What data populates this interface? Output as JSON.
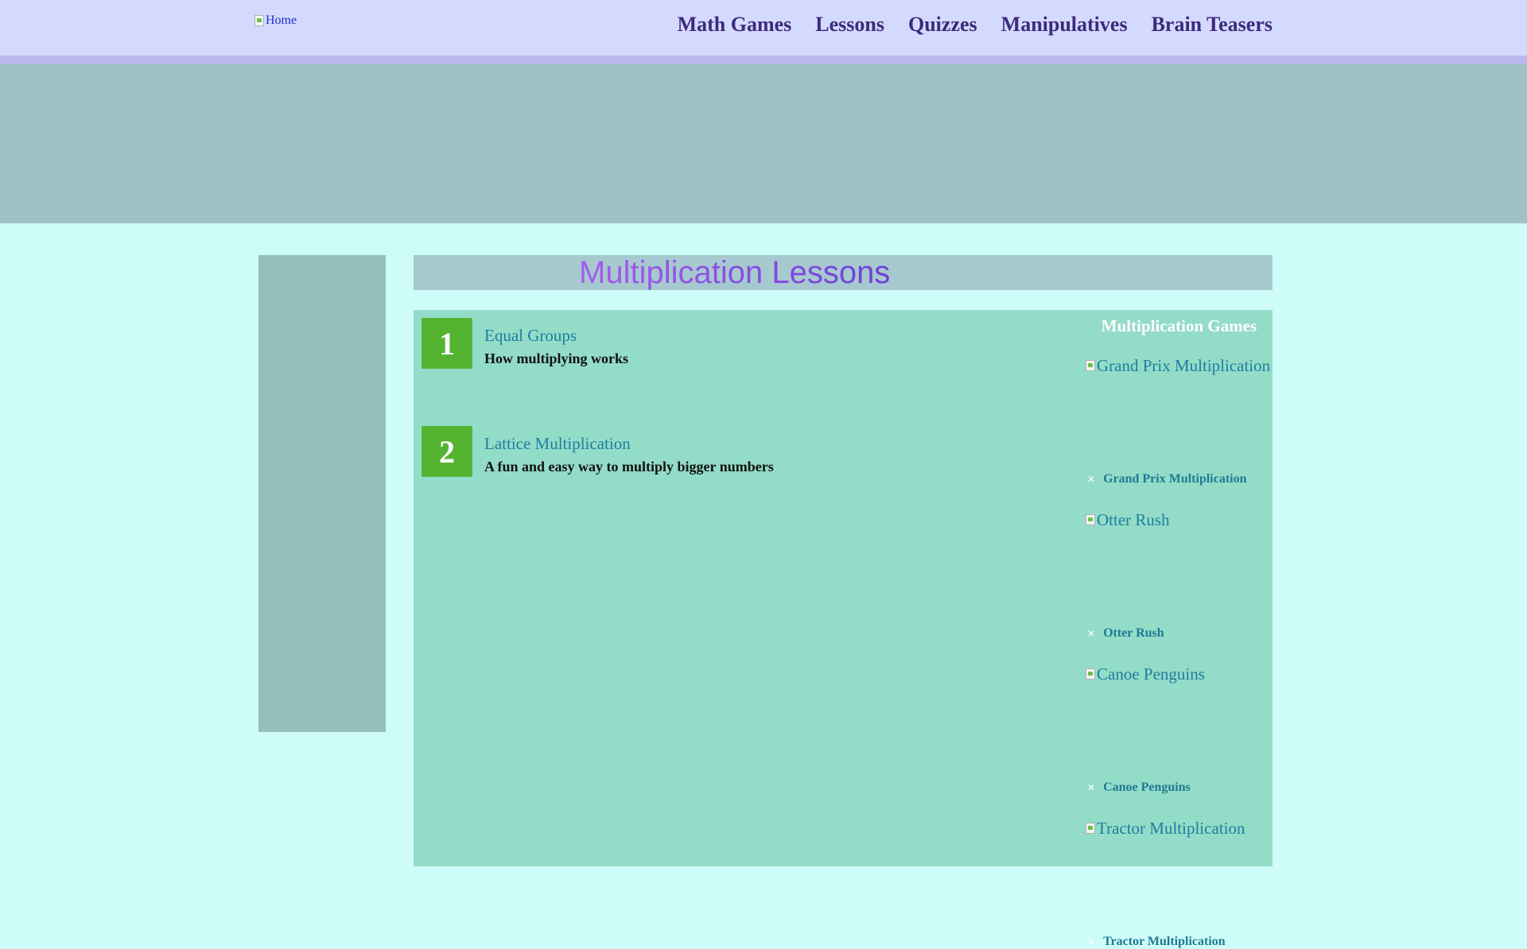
{
  "header": {
    "home_alt": "Home",
    "nav": [
      "Math Games",
      "Lessons",
      "Quizzes",
      "Manipulatives",
      "Brain Teasers"
    ]
  },
  "page": {
    "title": "Multiplication Lessons"
  },
  "lessons": [
    {
      "number": "1",
      "title": "Equal Groups",
      "description": "How multiplying works"
    },
    {
      "number": "2",
      "title": "Lattice Multiplication",
      "description": "A fun and easy way to multiply bigger numbers"
    }
  ],
  "games": {
    "heading": "Multiplication Games",
    "items": [
      {
        "image_alt": "Grand Prix Multiplication",
        "label": "Grand Prix Multiplication"
      },
      {
        "image_alt": "Otter Rush",
        "label": "Otter Rush"
      },
      {
        "image_alt": "Canoe Penguins",
        "label": "Canoe Penguins"
      },
      {
        "image_alt": "Tractor Multiplication",
        "label": "Tractor Multiplication"
      }
    ]
  },
  "colors": {
    "topbar": "#d3dafe",
    "banner": "#9ec2c6",
    "content": "#93dcc8",
    "lesson_badge": "#54b432",
    "nav_text": "#3e2a7c",
    "link": "#1f7ea0"
  }
}
